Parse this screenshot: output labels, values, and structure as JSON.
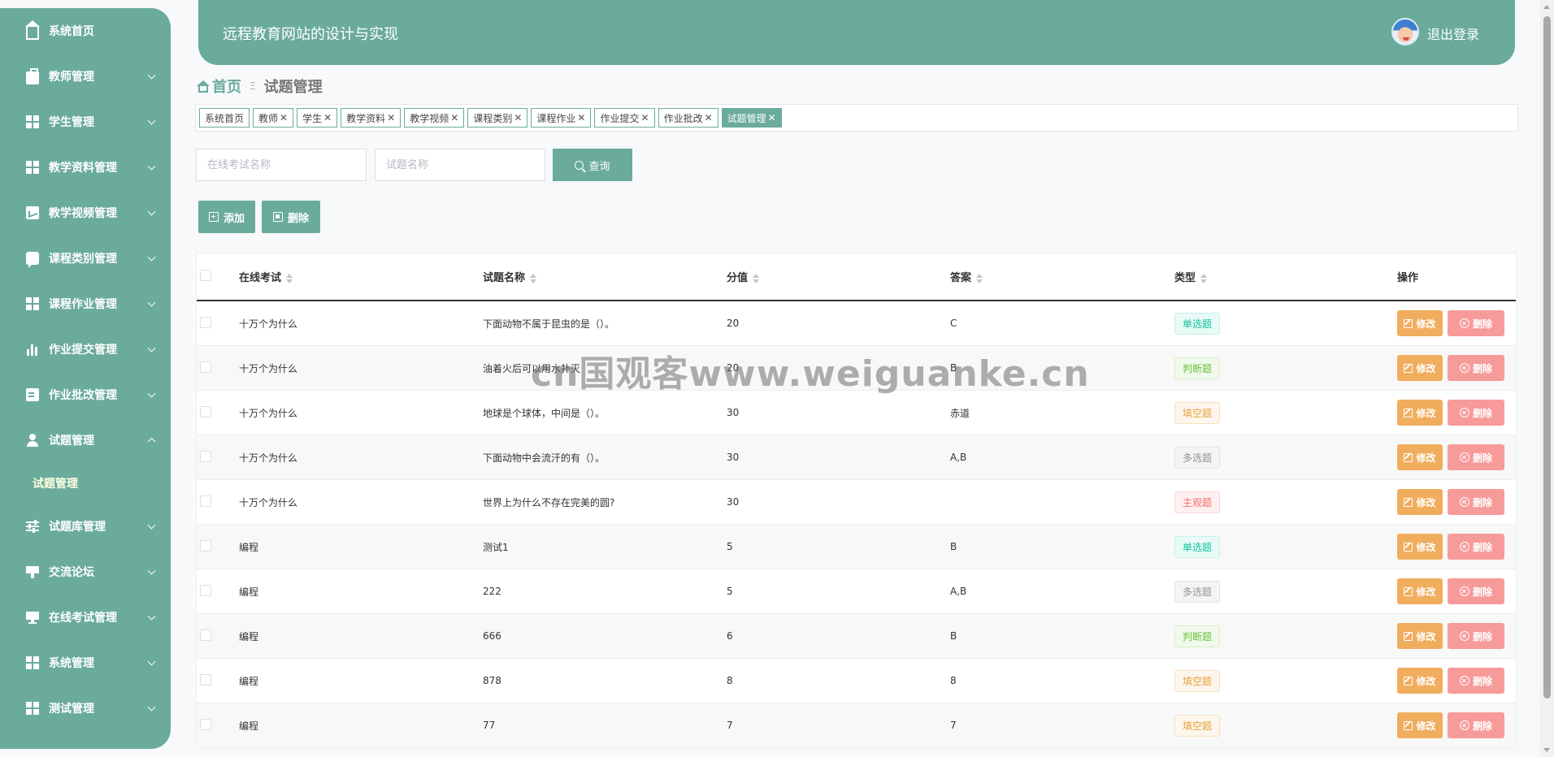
{
  "sidebar": {
    "items": [
      {
        "label": "系统首页",
        "icon": "home-icon",
        "expandable": false
      },
      {
        "label": "教师管理",
        "icon": "briefcase-icon",
        "expandable": true
      },
      {
        "label": "学生管理",
        "icon": "grid-icon",
        "expandable": true
      },
      {
        "label": "教学资料管理",
        "icon": "grid-icon",
        "expandable": true
      },
      {
        "label": "教学视频管理",
        "icon": "line-chart-icon",
        "expandable": true
      },
      {
        "label": "课程类别管理",
        "icon": "chat-icon",
        "expandable": true
      },
      {
        "label": "课程作业管理",
        "icon": "grid-icon",
        "expandable": true
      },
      {
        "label": "作业提交管理",
        "icon": "bar-chart-icon",
        "expandable": true
      },
      {
        "label": "作业批改管理",
        "icon": "clipboard-icon",
        "expandable": true
      },
      {
        "label": "试题管理",
        "icon": "user-icon",
        "expandable": true,
        "expanded": true
      },
      {
        "label": "试题库管理",
        "icon": "sliders-icon",
        "expandable": true
      },
      {
        "label": "交流论坛",
        "icon": "signpost-icon",
        "expandable": true
      },
      {
        "label": "在线考试管理",
        "icon": "monitor-icon",
        "expandable": true
      },
      {
        "label": "系统管理",
        "icon": "grid-icon",
        "expandable": true
      },
      {
        "label": "测试管理",
        "icon": "grid-icon",
        "expandable": true
      }
    ],
    "submenu": {
      "label": "试题管理"
    }
  },
  "header": {
    "title": "远程教育网站的设计与实现",
    "logout": "退出登录"
  },
  "breadcrumb": {
    "home": "首页",
    "separator": "Ξ",
    "current": "试题管理"
  },
  "tags": [
    {
      "label": "系统首页",
      "closable": false,
      "active": false
    },
    {
      "label": "教师",
      "closable": true,
      "active": false
    },
    {
      "label": "学生",
      "closable": true,
      "active": false
    },
    {
      "label": "教学资料",
      "closable": true,
      "active": false
    },
    {
      "label": "教学视频",
      "closable": true,
      "active": false
    },
    {
      "label": "课程类别",
      "closable": true,
      "active": false
    },
    {
      "label": "课程作业",
      "closable": true,
      "active": false
    },
    {
      "label": "作业提交",
      "closable": true,
      "active": false
    },
    {
      "label": "作业批改",
      "closable": true,
      "active": false
    },
    {
      "label": "试题管理",
      "closable": true,
      "active": true
    }
  ],
  "search": {
    "exam_placeholder": "在线考试名称",
    "name_placeholder": "试题名称",
    "query_label": "查询"
  },
  "actions": {
    "add_label": "添加",
    "delete_label": "删除"
  },
  "table": {
    "headers": {
      "exam": "在线考试",
      "name": "试题名称",
      "score": "分值",
      "answer": "答案",
      "type": "类型",
      "ops": "操作"
    },
    "edit_label": "修改",
    "delete_label": "删除",
    "rows": [
      {
        "exam": "十万个为什么",
        "name": "下面动物不属于昆虫的是（）。",
        "score": "20",
        "answer": "C",
        "type": "单选题",
        "type_style": "t-green"
      },
      {
        "exam": "十万个为什么",
        "name": "油着火后可以用水扑灭",
        "score": "20",
        "answer": "B",
        "type": "判断题",
        "type_style": "t-lime"
      },
      {
        "exam": "十万个为什么",
        "name": "地球是个球体，中间是（）。",
        "score": "30",
        "answer": "赤道",
        "type": "填空题",
        "type_style": "t-orange"
      },
      {
        "exam": "十万个为什么",
        "name": "下面动物中会流汗的有（）。",
        "score": "30",
        "answer": "A,B",
        "type": "多选题",
        "type_style": "t-gray"
      },
      {
        "exam": "十万个为什么",
        "name": "世界上为什么不存在完美的圆?",
        "score": "30",
        "answer": "",
        "type": "主观题",
        "type_style": "t-red"
      },
      {
        "exam": "编程",
        "name": "测试1",
        "score": "5",
        "answer": "B",
        "type": "单选题",
        "type_style": "t-green"
      },
      {
        "exam": "编程",
        "name": "222",
        "score": "5",
        "answer": "A,B",
        "type": "多选题",
        "type_style": "t-gray"
      },
      {
        "exam": "编程",
        "name": "666",
        "score": "6",
        "answer": "B",
        "type": "判断题",
        "type_style": "t-lime"
      },
      {
        "exam": "编程",
        "name": "878",
        "score": "8",
        "answer": "8",
        "type": "填空题",
        "type_style": "t-orange"
      },
      {
        "exam": "编程",
        "name": "77",
        "score": "7",
        "answer": "7",
        "type": "填空题",
        "type_style": "t-orange"
      }
    ]
  },
  "watermark": "cn国观客www.weiguanke.cn",
  "colors": {
    "primary": "#6aab9c",
    "edit": "#f0ad5e",
    "delete": "#f79a9a"
  }
}
